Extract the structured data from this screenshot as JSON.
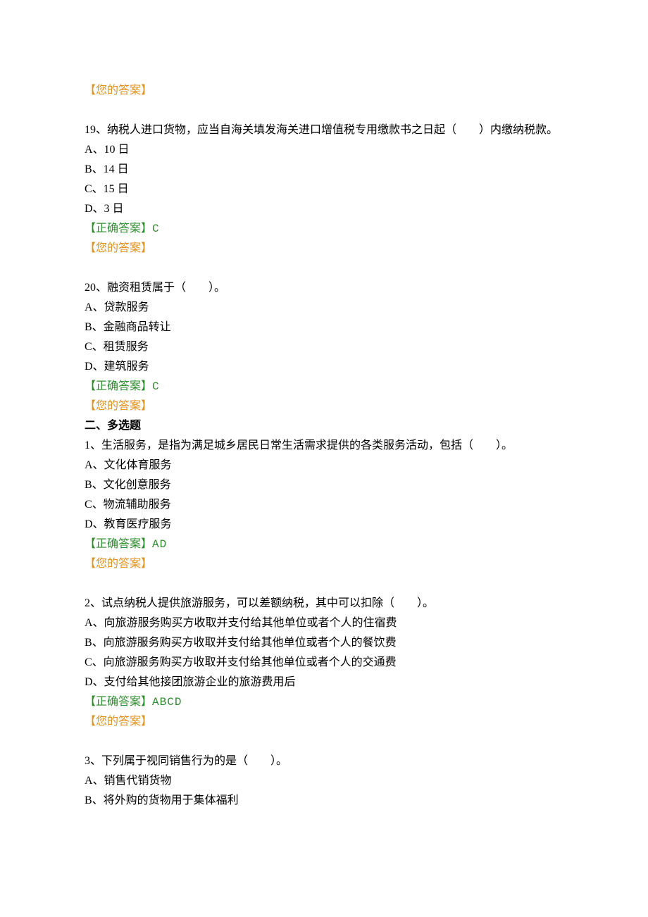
{
  "labels": {
    "your_answer": "【您的答案】",
    "correct_answer": "【正确答案】"
  },
  "blocks": [
    {
      "type": "your_answer"
    },
    {
      "type": "spacer"
    },
    {
      "type": "question",
      "text": "19、纳税人进口货物，应当自海关填发海关进口增值税专用缴款书之日起（　　）内缴纳税款。",
      "options": [
        "A、10 日",
        "B、14 日",
        "C、15 日",
        "D、3 日"
      ],
      "correct": "C"
    },
    {
      "type": "spacer"
    },
    {
      "type": "question",
      "text": "20、融资租赁属于（　　）。",
      "options": [
        "A、贷款服务",
        "B、金融商品转让",
        "C、租赁服务",
        "D、建筑服务"
      ],
      "correct": "C"
    },
    {
      "type": "section",
      "text": "二、多选题"
    },
    {
      "type": "question",
      "text": "1、生活服务，是指为满足城乡居民日常生活需求提供的各类服务活动，包括（　　）。",
      "options": [
        "A、文化体育服务",
        "B、文化创意服务",
        "C、物流辅助服务",
        "D、教育医疗服务"
      ],
      "correct": "AD"
    },
    {
      "type": "spacer"
    },
    {
      "type": "question",
      "text": "2、试点纳税人提供旅游服务，可以差额纳税，其中可以扣除（　　）。",
      "options": [
        "A、向旅游服务购买方收取并支付给其他单位或者个人的住宿费",
        "B、向旅游服务购买方收取并支付给其他单位或者个人的餐饮费",
        "C、向旅游服务购买方收取并支付给其他单位或者个人的交通费",
        "D、支付给其他接团旅游企业的旅游费用后"
      ],
      "correct": "ABCD"
    },
    {
      "type": "spacer"
    },
    {
      "type": "question_partial",
      "text": "3、下列属于视同销售行为的是（　　）。",
      "options": [
        "A、销售代销货物",
        "B、将外购的货物用于集体福利"
      ]
    }
  ]
}
